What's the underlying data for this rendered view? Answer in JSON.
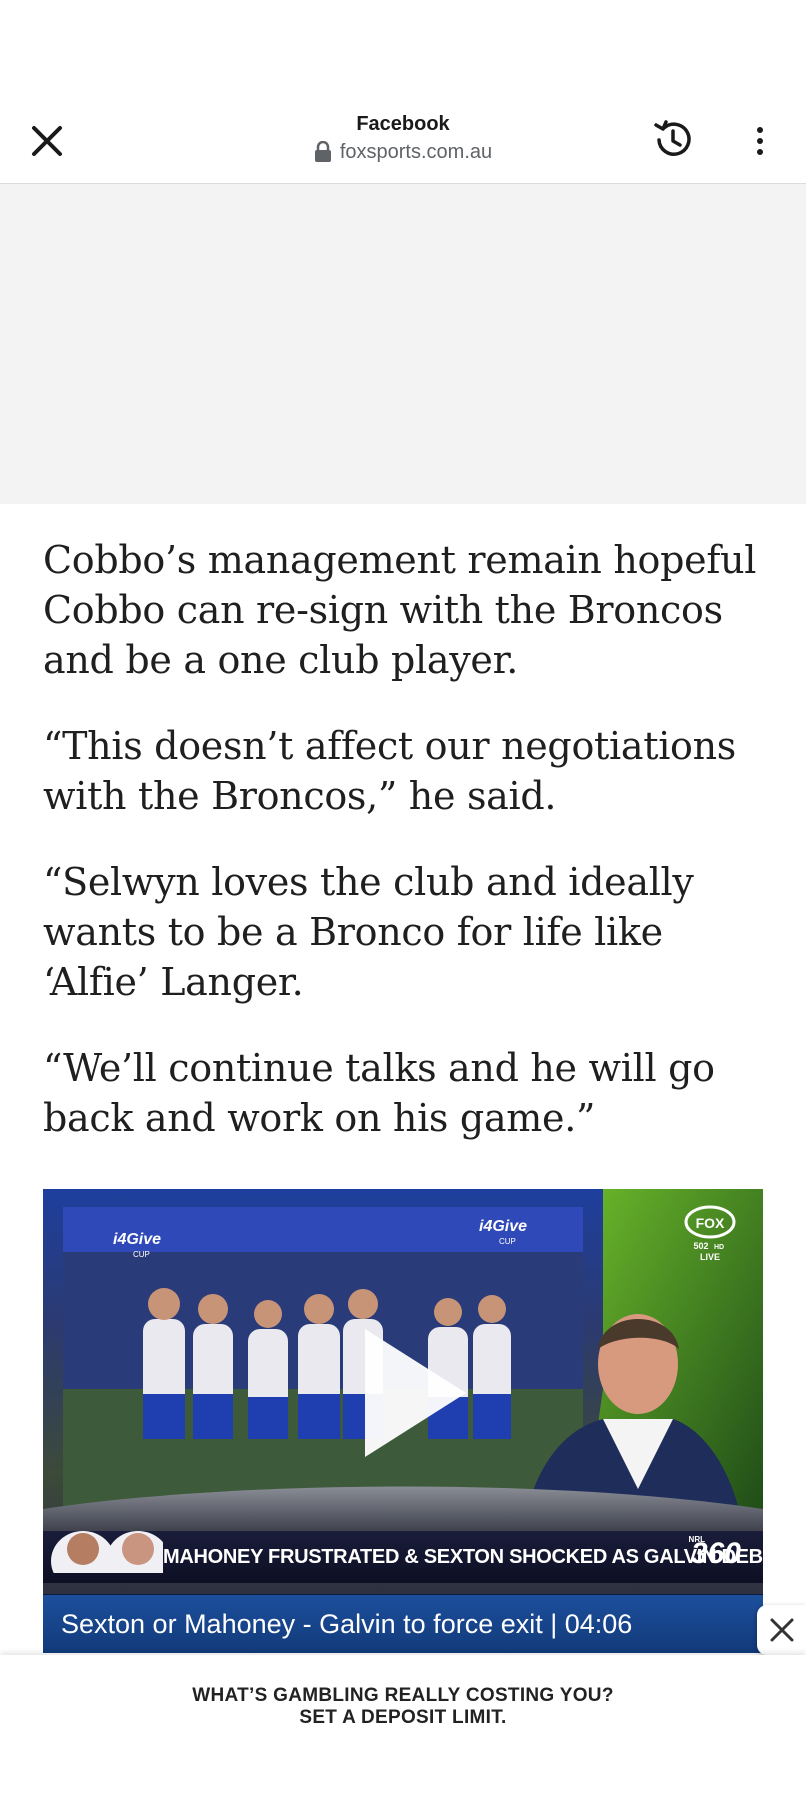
{
  "browser": {
    "title": "Facebook",
    "url": "foxsports.com.au",
    "close_icon": "close-icon",
    "history_icon": "history-icon",
    "more_icon": "more-vertical-icon"
  },
  "article": {
    "paragraphs": [
      "Cobbo’s management remain hopeful Cobbo can re-sign with the Broncos and be a one club player.",
      "“This doesn’t affect our negotiations with the Broncos,” he said.",
      "“Selwyn loves the club and ideally wants to be a Bronco for life like ‘Alfie’ Langer.",
      "“We’ll continue talks and he will go back and work on his game.”"
    ]
  },
  "video": {
    "caption": "Sexton or Mahoney - Galvin to force exit | 04:06",
    "ticker": "MAHONEY FRUSTRATED & SEXTON SHOCKED AS GALVIN DEBUTS",
    "show_logo": "360",
    "show_logo_small": "NRL",
    "channel_logo": "FOX",
    "channel_sub": "502",
    "channel_sub_hd": "HD",
    "channel_live": "LIVE",
    "board_text": "i4Give",
    "board_sub": "CUP"
  },
  "banner": {
    "line1": "WHAT’S GAMBLING REALLY COSTING YOU?",
    "line2": "SET A DEPOSIT LIMIT."
  },
  "colors": {
    "caption_bar": "#1c4f9c",
    "ticker_bg": "#1a1d3a",
    "studio_green": "#3a8a2a"
  }
}
